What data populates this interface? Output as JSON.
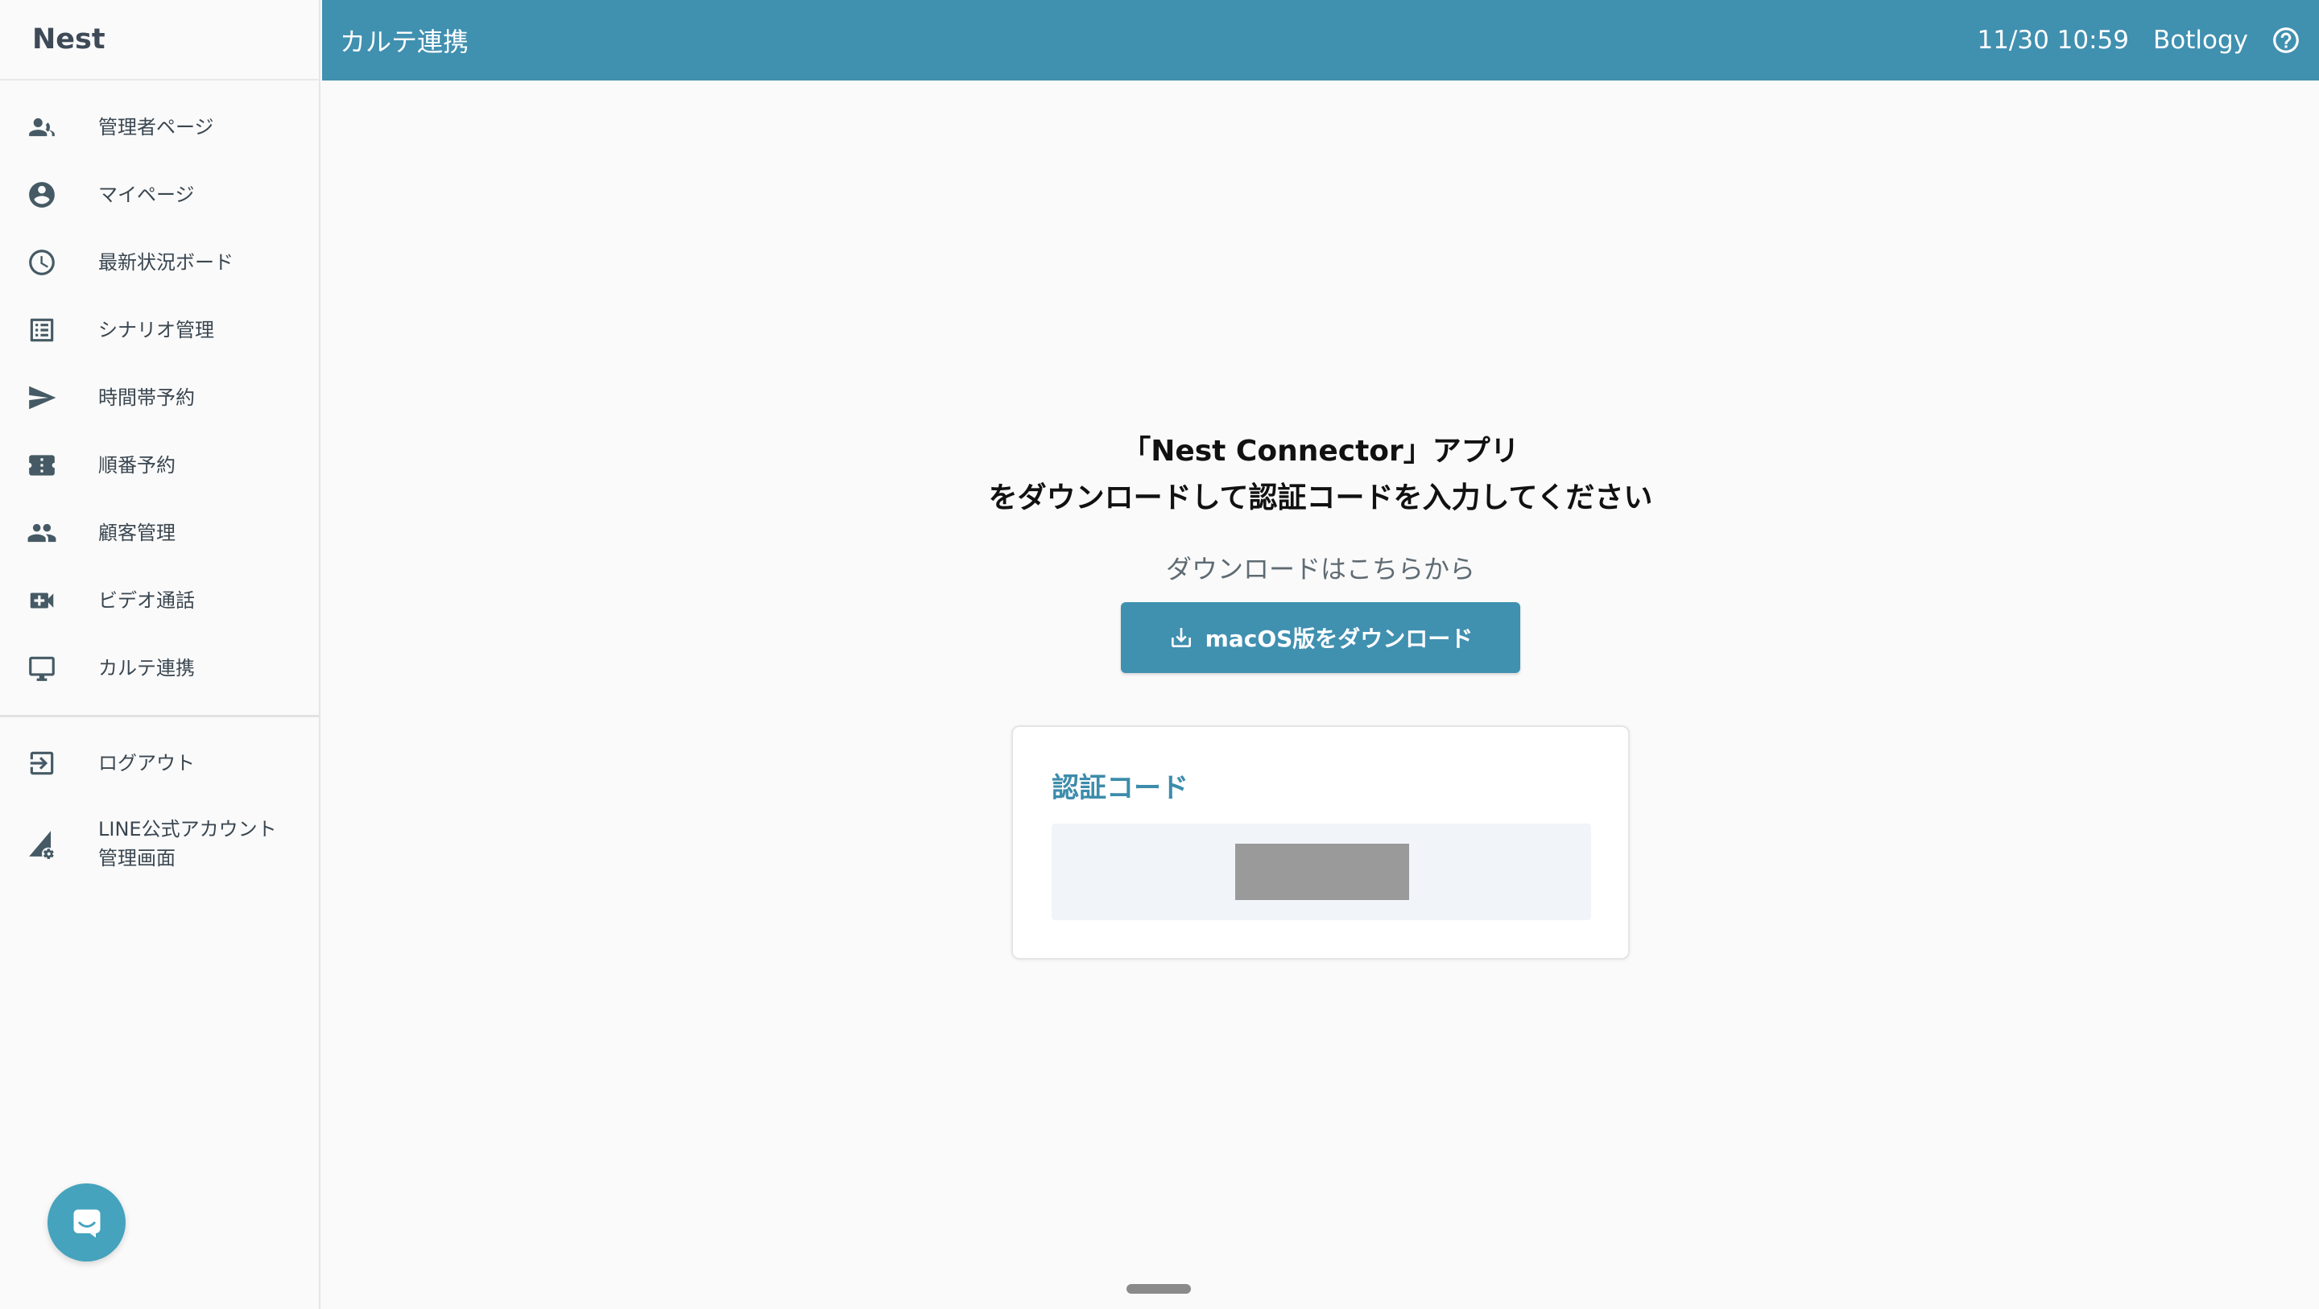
{
  "app": {
    "brand": "Nest"
  },
  "sidebar": {
    "items": [
      {
        "label": "管理者ページ",
        "icon": "admin-group-icon"
      },
      {
        "label": "マイページ",
        "icon": "account-circle-icon"
      },
      {
        "label": "最新状況ボード",
        "icon": "clock-icon"
      },
      {
        "label": "シナリオ管理",
        "icon": "list-icon"
      },
      {
        "label": "時間帯予約",
        "icon": "send-icon"
      },
      {
        "label": "順番予約",
        "icon": "ticket-icon"
      },
      {
        "label": "顧客管理",
        "icon": "people-icon"
      },
      {
        "label": "ビデオ通話",
        "icon": "videocam-icon"
      },
      {
        "label": "カルテ連携",
        "icon": "monitor-icon"
      }
    ],
    "footer_items": [
      {
        "label": "ログアウト",
        "icon": "logout-icon"
      },
      {
        "label_line1": "LINE公式アカウント",
        "label_line2": "管理画面",
        "icon": "signal-settings-icon"
      }
    ]
  },
  "header": {
    "title": "カルテ連携",
    "datetime": "11/30 10:59",
    "user": "Botlogy"
  },
  "main": {
    "heading_line1": "「Nest Connector」アプリ",
    "heading_line2": "をダウンロードして認証コードを入力してください",
    "download_prompt": "ダウンロードはこちらから",
    "download_button": "macOS版をダウンロード",
    "auth_card": {
      "title": "認証コード"
    }
  },
  "colors": {
    "primary": "#4090b0",
    "sidebar_bg": "#fafafa",
    "chat_bubble": "#45a3be"
  }
}
